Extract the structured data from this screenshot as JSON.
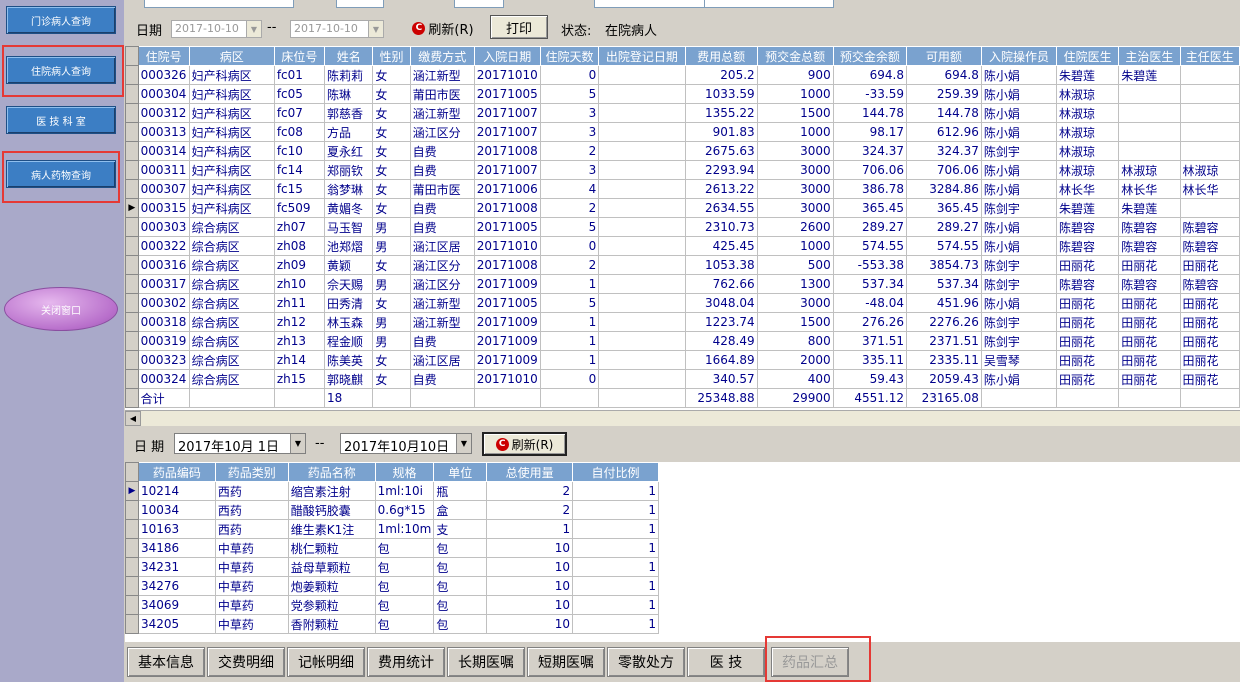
{
  "sidebar": {
    "items": [
      {
        "label": "门诊病人查询"
      },
      {
        "label": "住院病人查询"
      },
      {
        "label": "医 技 科 室"
      },
      {
        "label": "病人药物查询"
      }
    ],
    "exit_label": "关闭窗口"
  },
  "top_filter": {
    "date_label": "日期",
    "date_from": "2017-10-10",
    "separator": "--",
    "date_to": "2017-10-10",
    "refresh_label": "刷新(R)",
    "print_label": "打印",
    "status_label": "状态:",
    "status_value": "在院病人"
  },
  "patients": {
    "columns": [
      "住院号",
      "病区",
      "床位号",
      "姓名",
      "性别",
      "缴费方式",
      "入院日期",
      "住院天数",
      "出院登记日期",
      "费用总额",
      "预交金总额",
      "预交金余额",
      "可用额",
      "入院操作员",
      "住院医生",
      "主治医生",
      "主任医生"
    ],
    "rows": [
      [
        "000326",
        "妇产科病区",
        "fc01",
        "陈莉莉",
        "女",
        "涵江新型",
        "20171010",
        "0",
        "",
        "205.2",
        "900",
        "694.8",
        "694.8",
        "陈小娟",
        "朱碧莲",
        "朱碧莲",
        ""
      ],
      [
        "000304",
        "妇产科病区",
        "fc05",
        "陈琳",
        "女",
        "莆田市医",
        "20171005",
        "5",
        "",
        "1033.59",
        "1000",
        "-33.59",
        "259.39",
        "陈小娟",
        "林淑琼",
        "",
        ""
      ],
      [
        "000312",
        "妇产科病区",
        "fc07",
        "郭慈香",
        "女",
        "涵江新型",
        "20171007",
        "3",
        "",
        "1355.22",
        "1500",
        "144.78",
        "144.78",
        "陈小娟",
        "林淑琼",
        "",
        ""
      ],
      [
        "000313",
        "妇产科病区",
        "fc08",
        "方品",
        "女",
        "涵江区分",
        "20171007",
        "3",
        "",
        "901.83",
        "1000",
        "98.17",
        "612.96",
        "陈小娟",
        "林淑琼",
        "",
        ""
      ],
      [
        "000314",
        "妇产科病区",
        "fc10",
        "夏永红",
        "女",
        "自费",
        "20171008",
        "2",
        "",
        "2675.63",
        "3000",
        "324.37",
        "324.37",
        "陈剑宇",
        "林淑琼",
        "",
        ""
      ],
      [
        "000311",
        "妇产科病区",
        "fc14",
        "郑丽钦",
        "女",
        "自费",
        "20171007",
        "3",
        "",
        "2293.94",
        "3000",
        "706.06",
        "706.06",
        "陈小娟",
        "林淑琼",
        "林淑琼",
        "林淑琼"
      ],
      [
        "000307",
        "妇产科病区",
        "fc15",
        "翁梦琳",
        "女",
        "莆田市医",
        "20171006",
        "4",
        "",
        "2613.22",
        "3000",
        "386.78",
        "3284.86",
        "陈小娟",
        "林长华",
        "林长华",
        "林长华"
      ],
      [
        "000315",
        "妇产科病区",
        "fc509",
        "黄媚冬",
        "女",
        "自费",
        "20171008",
        "2",
        "",
        "2634.55",
        "3000",
        "365.45",
        "365.45",
        "陈剑宇",
        "朱碧莲",
        "朱碧莲",
        ""
      ],
      [
        "000303",
        "综合病区",
        "zh07",
        "马玉智",
        "男",
        "自费",
        "20171005",
        "5",
        "",
        "2310.73",
        "2600",
        "289.27",
        "289.27",
        "陈小娟",
        "陈碧容",
        "陈碧容",
        "陈碧容"
      ],
      [
        "000322",
        "综合病区",
        "zh08",
        "池郑熠",
        "男",
        "涵江区居",
        "20171010",
        "0",
        "",
        "425.45",
        "1000",
        "574.55",
        "574.55",
        "陈小娟",
        "陈碧容",
        "陈碧容",
        "陈碧容"
      ],
      [
        "000316",
        "综合病区",
        "zh09",
        "黄颖",
        "女",
        "涵江区分",
        "20171008",
        "2",
        "",
        "1053.38",
        "500",
        "-553.38",
        "3854.73",
        "陈剑宇",
        "田丽花",
        "田丽花",
        "田丽花"
      ],
      [
        "000317",
        "综合病区",
        "zh10",
        "佘天赐",
        "男",
        "涵江区分",
        "20171009",
        "1",
        "",
        "762.66",
        "1300",
        "537.34",
        "537.34",
        "陈剑宇",
        "陈碧容",
        "陈碧容",
        "陈碧容"
      ],
      [
        "000302",
        "综合病区",
        "zh11",
        "田秀清",
        "女",
        "涵江新型",
        "20171005",
        "5",
        "",
        "3048.04",
        "3000",
        "-48.04",
        "451.96",
        "陈小娟",
        "田丽花",
        "田丽花",
        "田丽花"
      ],
      [
        "000318",
        "综合病区",
        "zh12",
        "林玉森",
        "男",
        "涵江新型",
        "20171009",
        "1",
        "",
        "1223.74",
        "1500",
        "276.26",
        "2276.26",
        "陈剑宇",
        "田丽花",
        "田丽花",
        "田丽花"
      ],
      [
        "000319",
        "综合病区",
        "zh13",
        "程金顺",
        "男",
        "自费",
        "20171009",
        "1",
        "",
        "428.49",
        "800",
        "371.51",
        "2371.51",
        "陈剑宇",
        "田丽花",
        "田丽花",
        "田丽花"
      ],
      [
        "000323",
        "综合病区",
        "zh14",
        "陈美英",
        "女",
        "涵江区居",
        "20171009",
        "1",
        "",
        "1664.89",
        "2000",
        "335.11",
        "2335.11",
        "吴雪琴",
        "田丽花",
        "田丽花",
        "田丽花"
      ],
      [
        "000324",
        "综合病区",
        "zh15",
        "郭晓麒",
        "女",
        "自费",
        "20171010",
        "0",
        "",
        "340.57",
        "400",
        "59.43",
        "2059.43",
        "陈小娟",
        "田丽花",
        "田丽花",
        "田丽花"
      ]
    ],
    "total_row": [
      "合计",
      "",
      "",
      "18",
      "",
      "",
      "",
      "",
      "",
      "25348.88",
      "29900",
      "4551.12",
      "23165.08",
      "",
      "",
      "",
      ""
    ]
  },
  "drug_filter": {
    "date_label": "日 期",
    "date_from": "2017年10月 1日",
    "separator": "--",
    "date_to": "2017年10月10日",
    "refresh_label": "刷新(R)"
  },
  "drugs": {
    "columns": [
      "药品编码",
      "药品类别",
      "药品名称",
      "规格",
      "单位",
      "总使用量",
      "自付比例"
    ],
    "rows": [
      [
        "10214",
        "西药",
        "缩宫素注射",
        "1ml:10i",
        "瓶",
        "2",
        "1"
      ],
      [
        "10034",
        "西药",
        "醋酸钙胶囊",
        "0.6g*15",
        "盒",
        "2",
        "1"
      ],
      [
        "10163",
        "西药",
        "维生素K1注",
        "1ml:10m",
        "支",
        "1",
        "1"
      ],
      [
        "34186",
        "中草药",
        "桃仁颗粒",
        "包",
        "包",
        "10",
        "1"
      ],
      [
        "34231",
        "中草药",
        "益母草颗粒",
        "包",
        "包",
        "10",
        "1"
      ],
      [
        "34276",
        "中草药",
        "炮姜颗粒",
        "包",
        "包",
        "10",
        "1"
      ],
      [
        "34069",
        "中草药",
        "党参颗粒",
        "包",
        "包",
        "10",
        "1"
      ],
      [
        "34205",
        "中草药",
        "香附颗粒",
        "包",
        "包",
        "10",
        "1"
      ]
    ]
  },
  "tabs": [
    {
      "label": "基本信息"
    },
    {
      "label": "交费明细"
    },
    {
      "label": "记帐明细"
    },
    {
      "label": "费用统计"
    },
    {
      "label": "长期医嘱"
    },
    {
      "label": "短期医嘱"
    },
    {
      "label": "零散处方"
    },
    {
      "label": "医  技"
    },
    {
      "label": "药品汇总"
    }
  ]
}
